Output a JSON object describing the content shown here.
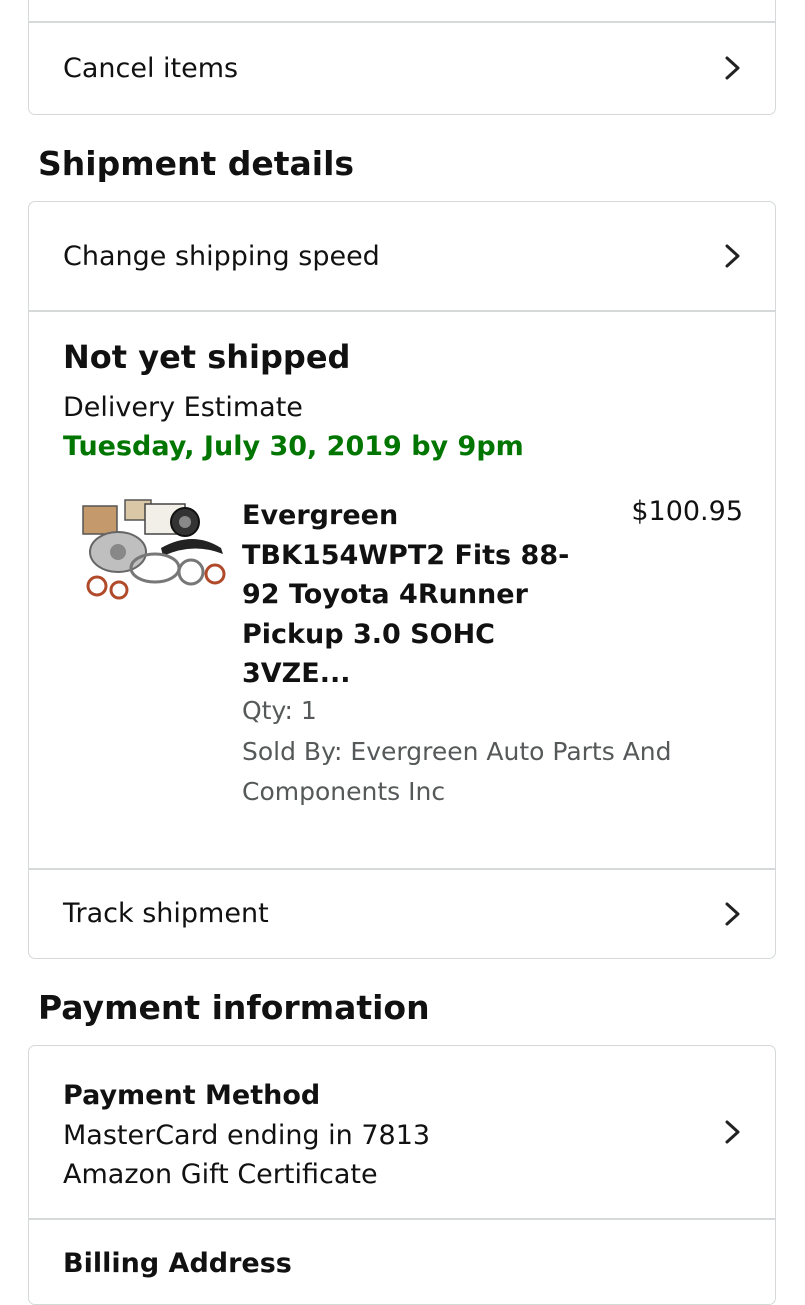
{
  "cancel": {
    "label": "Cancel items"
  },
  "shipment": {
    "title": "Shipment details",
    "change_speed_label": "Change shipping speed",
    "status": "Not yet shipped",
    "estimate_label": "Delivery Estimate",
    "estimate_date": "Tuesday, July 30, 2019 by 9pm",
    "estimate_color": "#007600",
    "item": {
      "title_lines": [
        "Evergreen",
        "TBK154WPT2 Fits 88-",
        "92 Toyota 4Runner",
        "Pickup 3.0 SOHC",
        "3VZE..."
      ],
      "price": "$100.95",
      "qty": "Qty: 1",
      "sold_by_lines": [
        "Sold By: Evergreen Auto Parts And",
        "Components Inc"
      ],
      "image_icon": "timing-belt-kit-image"
    },
    "track_label": "Track shipment"
  },
  "payment": {
    "title": "Payment information",
    "method_label": "Payment Method",
    "method_lines": [
      "MasterCard ending in 7813",
      "Amazon Gift Certificate"
    ],
    "billing_label": "Billing Address"
  }
}
